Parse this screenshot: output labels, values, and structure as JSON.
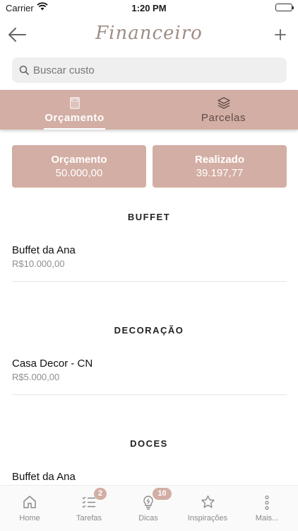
{
  "status_bar": {
    "carrier": "Carrier",
    "time": "1:20 PM"
  },
  "nav": {
    "title": "Financeiro",
    "back_icon": "arrow-left-icon",
    "add_icon": "plus-icon"
  },
  "search": {
    "placeholder": "Buscar custo",
    "value": ""
  },
  "tabs": [
    {
      "label": "Orçamento",
      "icon": "calculator-icon",
      "selected": true
    },
    {
      "label": "Parcelas",
      "icon": "layers-icon",
      "selected": false
    }
  ],
  "summary": {
    "budget": {
      "label": "Orçamento",
      "value": "50.000,00"
    },
    "realized": {
      "label": "Realizado",
      "value": "39.197,77"
    }
  },
  "sections": [
    {
      "title": "BUFFET",
      "items": [
        {
          "name": "Buffet da Ana",
          "amount": "R$10.000,00"
        }
      ]
    },
    {
      "title": "DECORAÇÃO",
      "items": [
        {
          "name": "Casa Decor - CN",
          "amount": "R$5.000,00"
        }
      ]
    },
    {
      "title": "DOCES",
      "items": [
        {
          "name": "Buffet da Ana",
          "amount": ""
        }
      ]
    }
  ],
  "tabbar": [
    {
      "label": "Home",
      "icon": "home-icon",
      "badge": ""
    },
    {
      "label": "Tarefas",
      "icon": "checklist-icon",
      "badge": "2"
    },
    {
      "label": "Dicas",
      "icon": "lightbulb-icon",
      "badge": "10"
    },
    {
      "label": "Inspirações",
      "icon": "star-icon",
      "badge": ""
    },
    {
      "label": "Mais...",
      "icon": "more-vertical-icon",
      "badge": ""
    }
  ],
  "colors": {
    "accent": "#d3aea4",
    "title": "#a08c86"
  }
}
